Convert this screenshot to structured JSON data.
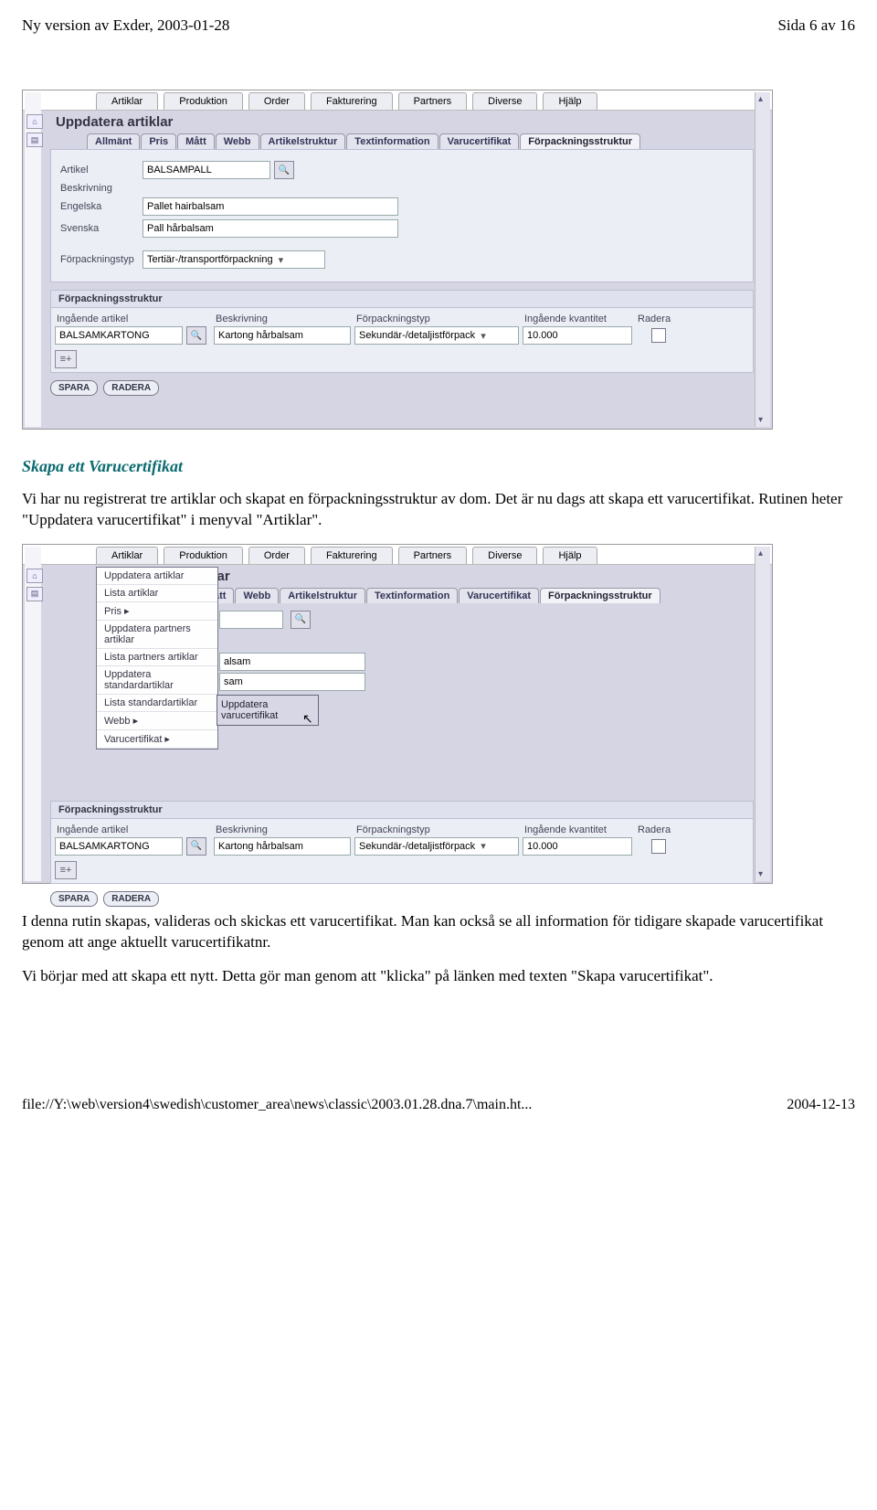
{
  "header": {
    "left": "Ny version av Exder, 2003-01-28",
    "right": "Sida 6 av 16"
  },
  "footer": {
    "left": "file://Y:\\web\\version4\\swedish\\customer_area\\news\\classic\\2003.01.28.dna.7\\main.ht...",
    "right": "2004-12-13"
  },
  "menubar": [
    "Artiklar",
    "Produktion",
    "Order",
    "Fakturering",
    "Partners",
    "Diverse",
    "Hjälp"
  ],
  "title1": "Uppdatera artiklar",
  "tabs": [
    "Allmänt",
    "Pris",
    "Mått",
    "Webb",
    "Artikelstruktur",
    "Textinformation",
    "Varucertifikat",
    "Förpackningsstruktur"
  ],
  "form1": {
    "artikelLabel": "Artikel",
    "artikelValue": "BALSAMPALL",
    "beskrivningLabel": "Beskrivning",
    "engLabel": "Engelska",
    "engValue": "Pallet hairbalsam",
    "sveLabel": "Svenska",
    "sveValue": "Pall hårbalsam",
    "forptypLabel": "Förpackningstyp",
    "forptypValue": "Tertiär-/transportförpackning"
  },
  "gridHead": {
    "title": "Förpackningsstruktur",
    "h1": "Ingående artikel",
    "h2": "Beskrivning",
    "h3": "Förpackningstyp",
    "h4": "Ingående kvantitet",
    "h5": "Radera"
  },
  "gridRow1": {
    "art": "BALSAMKARTONG",
    "besk": "Kartong hårbalsam",
    "typ": "Sekundär-/detaljistförpack",
    "kv": "10.000"
  },
  "btns": {
    "spara": "SPARA",
    "radera": "RADERA"
  },
  "text": {
    "h2": "Skapa ett Varucertifikat",
    "p1": "Vi har nu registrerat tre artiklar och skapat en förpackningsstruktur av dom. Det är nu dags att skapa ett varucertifikat. Rutinen heter \"Uppdatera varucertifikat\" i menyval \"Artiklar\".",
    "p2": "I denna rutin skapas, valideras och skickas ett varucertifikat. Man kan också se all information för tidigare skapade varucertifikat genom att ange aktuellt varucertifikatnr.",
    "p3": "Vi börjar med att skapa ett nytt. Detta gör man genom att \"klicka\" på länken med texten \"Skapa varucertifikat\"."
  },
  "menu2": {
    "title_fragment": "klar",
    "items": [
      "Uppdatera artiklar",
      "Lista artiklar",
      "Pris  ▸",
      "Uppdatera partners artiklar",
      "Lista partners artiklar",
      "Uppdatera standardartiklar",
      "Lista standardartiklar",
      "Webb  ▸",
      "Varucertifikat  ▸"
    ],
    "submenu": "Uppdatera varucertifikat",
    "tabs_visible": [
      "ätt",
      "Webb",
      "Artikelstruktur",
      "Textinformation",
      "Varucertifikat",
      "Förpackningsstruktur"
    ],
    "field_frag1": "alsam",
    "field_frag2": "sam",
    "bottom_label": "Förpackningstyp"
  }
}
